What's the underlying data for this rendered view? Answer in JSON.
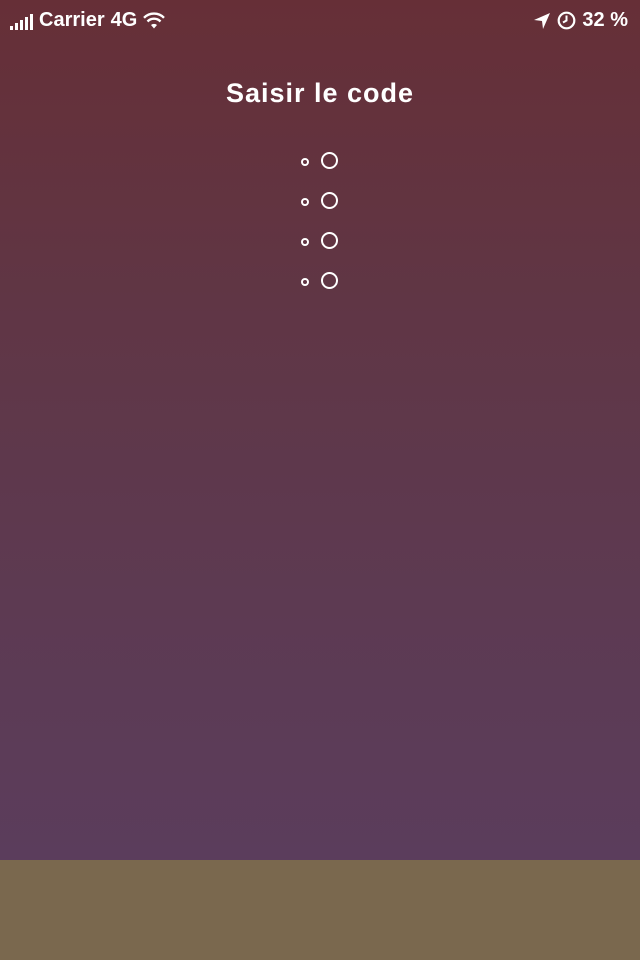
{
  "status_bar": {
    "carrier": "Carrier",
    "network": "4G",
    "battery": "32 %"
  },
  "screen": {
    "title": "Saisir le code"
  },
  "code": {
    "length": 4,
    "entered": 0
  },
  "colors": {
    "background_top": "#662f37",
    "background_bottom": "#5b3d5c",
    "footer": "#7a684e",
    "foreground": "#ffffff"
  }
}
